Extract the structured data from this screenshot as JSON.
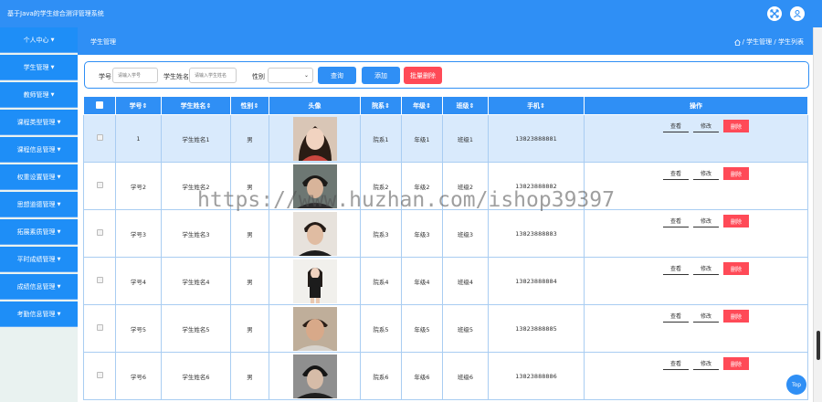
{
  "app": {
    "title": "基于Java的学生综合测评管理系统"
  },
  "sidebar": {
    "items": [
      {
        "label": "个人中心"
      },
      {
        "label": "学生管理"
      },
      {
        "label": "教师管理"
      },
      {
        "label": "课程类型管理"
      },
      {
        "label": "课程信息管理"
      },
      {
        "label": "权重设置管理"
      },
      {
        "label": "思想道德管理"
      },
      {
        "label": "拓展素质管理"
      },
      {
        "label": "平时成绩管理"
      },
      {
        "label": "成绩信息管理"
      },
      {
        "label": "考勤信息管理"
      }
    ]
  },
  "page": {
    "title": "学生管理",
    "breadcrumb": "/ 学生管理 / 学生列表"
  },
  "search": {
    "id_label": "学号",
    "id_placeholder": "请输入学号",
    "name_label": "学生姓名",
    "name_placeholder": "请输入学生姓名",
    "gender_label": "性别",
    "gender_value": "",
    "query_button": "查询",
    "add_button": "添加",
    "batch_delete_button": "批量删除"
  },
  "table": {
    "headers": [
      "学号",
      "学生姓名",
      "性别",
      "头像",
      "院系",
      "年级",
      "班级",
      "手机",
      "操作"
    ],
    "rows": [
      {
        "id": "1",
        "name": "学生姓名1",
        "gender": "男",
        "dept": "院系1",
        "grade": "年级1",
        "class": "班级1",
        "phone": "13823888881"
      },
      {
        "id": "学号2",
        "name": "学生姓名2",
        "gender": "男",
        "dept": "院系2",
        "grade": "年级2",
        "class": "班级2",
        "phone": "13823888882"
      },
      {
        "id": "学号3",
        "name": "学生姓名3",
        "gender": "男",
        "dept": "院系3",
        "grade": "年级3",
        "class": "班级3",
        "phone": "13823888883"
      },
      {
        "id": "学号4",
        "name": "学生姓名4",
        "gender": "男",
        "dept": "院系4",
        "grade": "年级4",
        "class": "班级4",
        "phone": "13823888884"
      },
      {
        "id": "学号5",
        "name": "学生姓名5",
        "gender": "男",
        "dept": "院系5",
        "grade": "年级5",
        "class": "班级5",
        "phone": "13823888885"
      },
      {
        "id": "学号6",
        "name": "学生姓名6",
        "gender": "男",
        "dept": "院系6",
        "grade": "年级6",
        "class": "班级6",
        "phone": "13823888886"
      }
    ],
    "actions": {
      "view": "查看",
      "edit": "修改",
      "delete": "删除"
    }
  },
  "to_top": "Top",
  "watermark": "https://www.huzhan.com/ishop39397",
  "colors": {
    "primary": "#2f8ff5",
    "danger": "#ff4a57",
    "selected_row": "#d9eafc"
  }
}
